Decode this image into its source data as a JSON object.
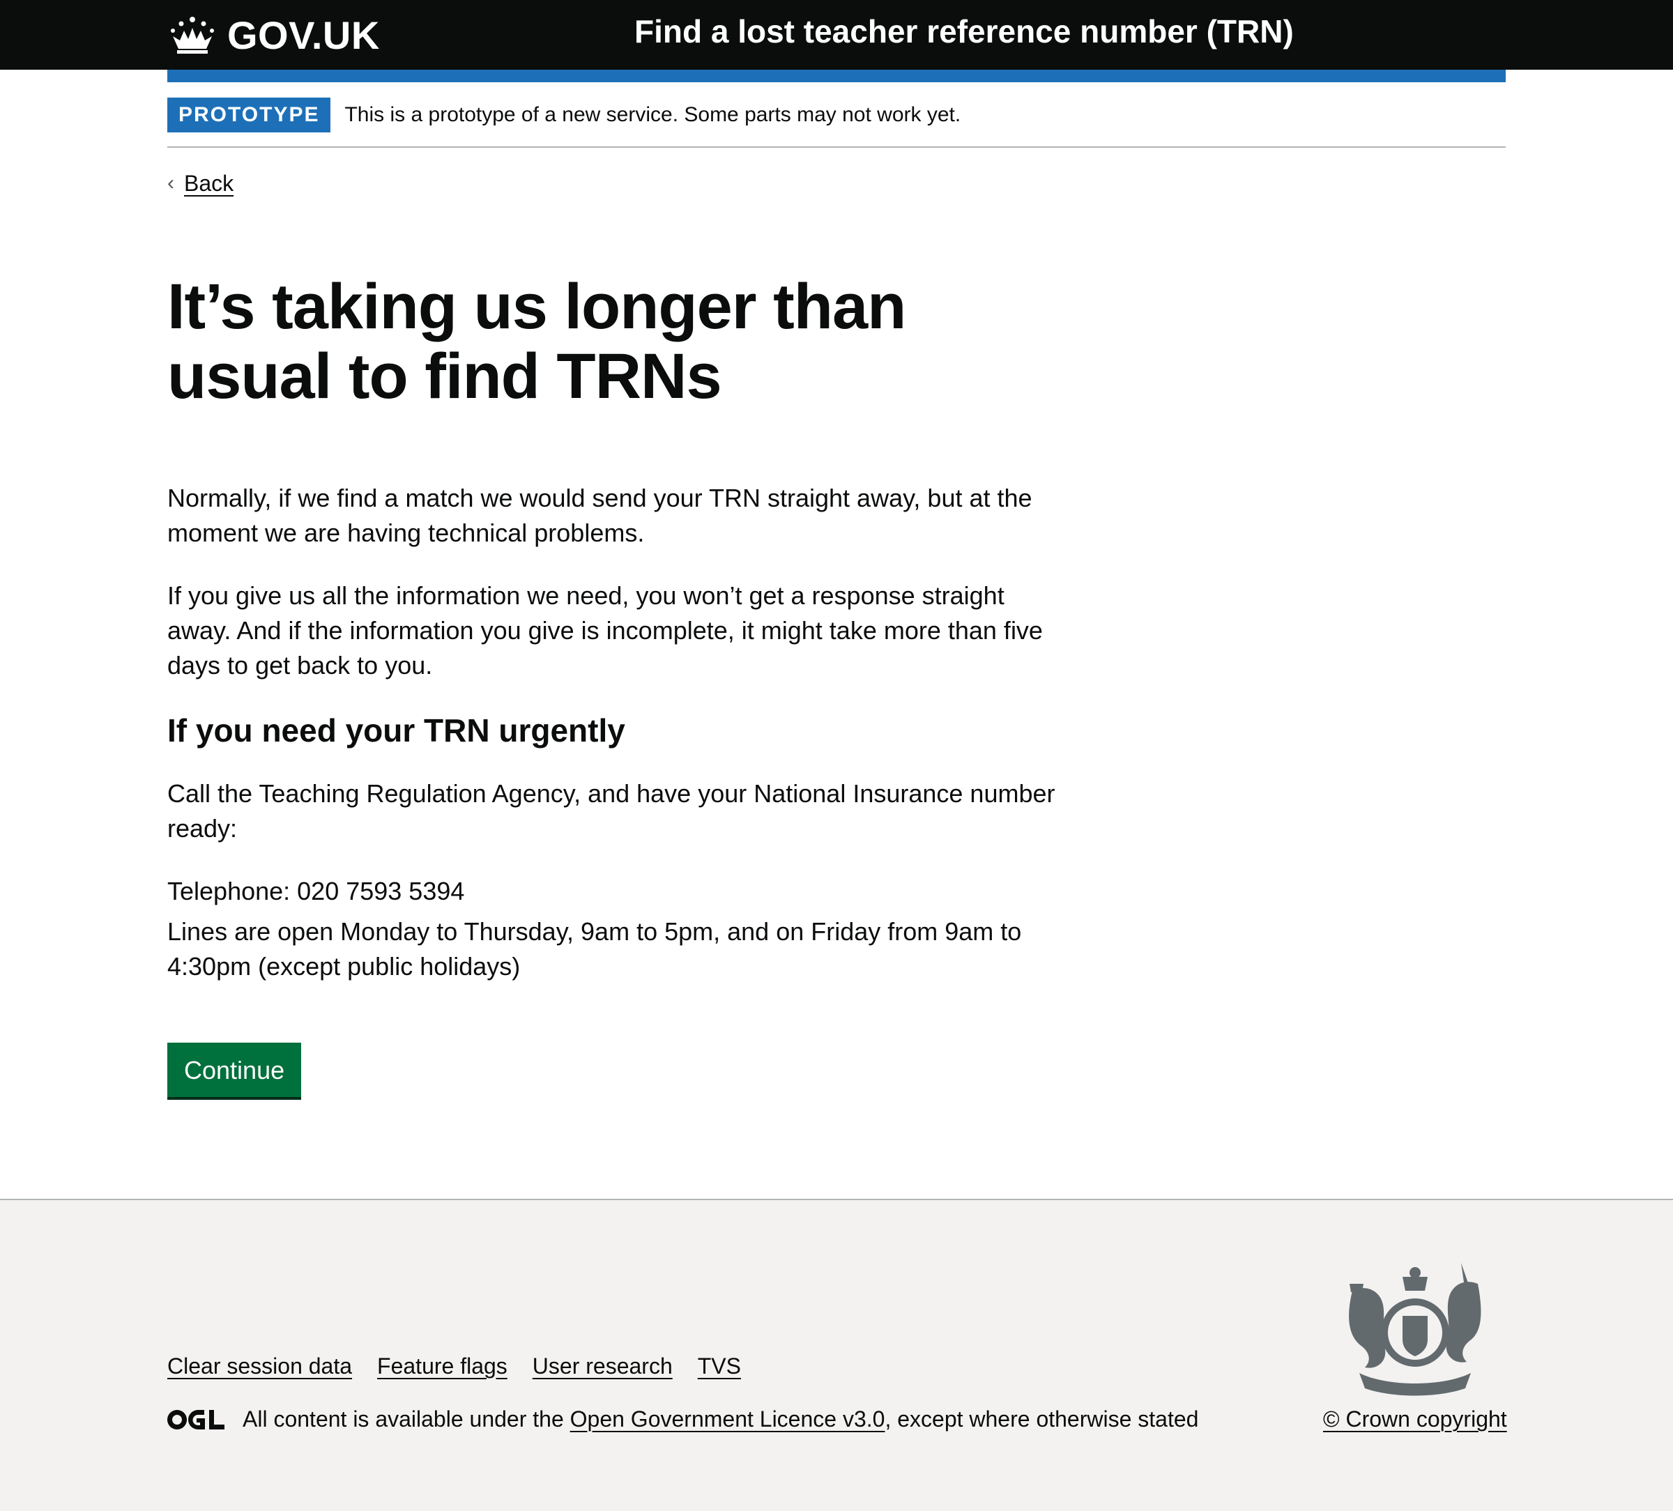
{
  "header": {
    "logo_text": "GOV.UK",
    "service_name": "Find a lost teacher reference number (TRN)"
  },
  "phase_banner": {
    "tag": "PROTOTYPE",
    "text": "This is a prototype of a new service. Some parts may not work yet."
  },
  "back_link": {
    "label": "Back"
  },
  "main": {
    "heading_line1": "It’s taking us longer than",
    "heading_line2": "usual to find TRNs",
    "paragraph1": "Normally, if we find a match we would send your TRN straight away, but at the moment we are having technical problems.",
    "paragraph2": "If you give us all the information we need, you won’t get a response straight away. And if the information you give is incomplete, it might take more than five days to get back to you.",
    "subheading": "If you need your TRN urgently",
    "paragraph3": "Call the Teaching Regulation Agency, and have your National Insurance number ready:",
    "telephone": "Telephone: 020 7593 5394",
    "opening_hours": "Lines are open Monday to Thursday, 9am to 5pm, and on Friday from 9am to 4:30pm (except public holidays)",
    "continue_label": "Continue"
  },
  "footer": {
    "links": [
      "Clear session data",
      "Feature flags",
      "User research",
      "TVS"
    ],
    "licence_prefix": "All content is available under the ",
    "licence_link": "Open Government Licence v3.0",
    "licence_suffix": ", except where otherwise stated",
    "copyright": "© Crown copyright"
  },
  "colors": {
    "header_bg": "#0b0c0c",
    "brand_blue": "#1d70b8",
    "button_green": "#00703c",
    "footer_bg": "#f3f2f1"
  }
}
